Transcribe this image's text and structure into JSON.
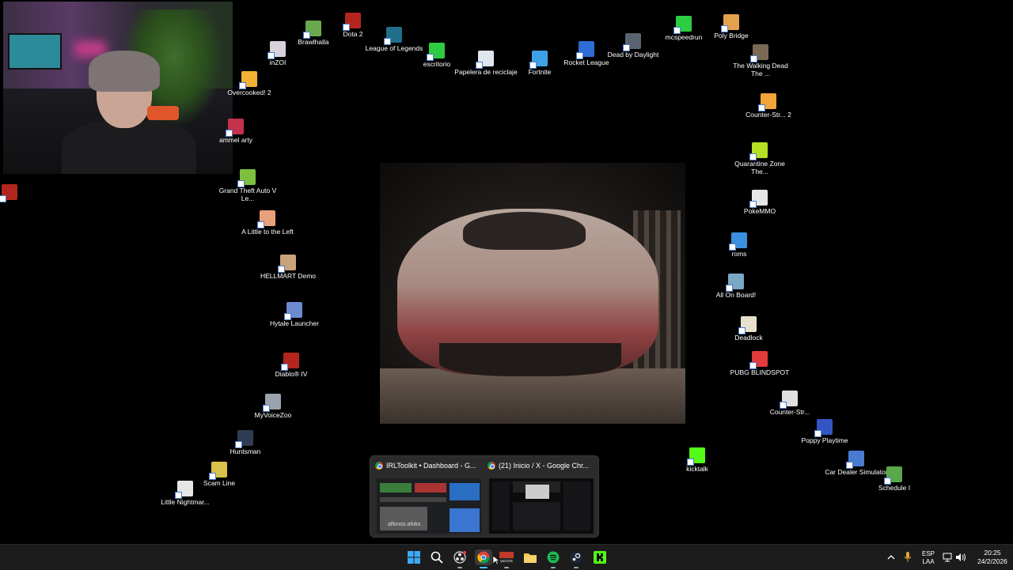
{
  "desktop_icons": [
    {
      "label": "Brawlhalla",
      "icon": "brawlhalla-icon",
      "color": "#6aa84f"
    },
    {
      "label": "Dota 2",
      "icon": "dota2-icon",
      "color": "#b3261e"
    },
    {
      "label": "League of Legends",
      "icon": "league-of-legends-icon",
      "color": "#1f6f8b"
    },
    {
      "label": "escritorio",
      "icon": "tree-icon",
      "color": "#2ecc40"
    },
    {
      "label": "Papelera de reciclaje",
      "icon": "recycle-bin-icon",
      "color": "#dfe6ee"
    },
    {
      "label": "Fortnite",
      "icon": "fortnite-icon",
      "color": "#3ea0e6"
    },
    {
      "label": "Rocket League",
      "icon": "rocket-league-icon",
      "color": "#2d6dd4"
    },
    {
      "label": "Dead by Daylight",
      "icon": "dead-by-daylight-icon",
      "color": "#5a6470"
    },
    {
      "label": "mcspeedrun",
      "icon": "tree-icon",
      "color": "#2ecc40"
    },
    {
      "label": "Poly Bridge",
      "icon": "poly-bridge-icon",
      "color": "#e3a14b"
    },
    {
      "label": "inZOI",
      "icon": "inzoi-icon",
      "color": "#d7d2db"
    },
    {
      "label": "Overcooked! 2",
      "icon": "overcooked-icon",
      "color": "#f2b134"
    },
    {
      "label": "ammel arty",
      "icon": "game-icon",
      "color": "#c4314b"
    },
    {
      "label": "Grand Theft Auto V Le...",
      "icon": "gta-v-icon",
      "color": "#7fbf3f"
    },
    {
      "label": "A Little to the Left",
      "icon": "a-little-to-the-left-icon",
      "color": "#e8a07a"
    },
    {
      "label": "HELLMART Demo",
      "icon": "hellmart-icon",
      "color": "#c9a37a"
    },
    {
      "label": "Hytale Launcher",
      "icon": "hytale-icon",
      "color": "#6c8ad0"
    },
    {
      "label": "Diablo® IV",
      "icon": "diablo-icon",
      "color": "#b3261e"
    },
    {
      "label": "MyVoiceZoo",
      "icon": "myvoicezoo-icon",
      "color": "#9aa3ad"
    },
    {
      "label": "Huntsman",
      "icon": "huntsman-icon",
      "color": "#2f3b52"
    },
    {
      "label": "Scam Line",
      "icon": "scam-line-icon",
      "color": "#d9c24a"
    },
    {
      "label": "Little Nightmar...",
      "icon": "little-nightmares-icon",
      "color": "#e6e6e6"
    },
    {
      "label": "The Walking Dead The ...",
      "icon": "walking-dead-icon",
      "color": "#7a6a55"
    },
    {
      "label": "Counter-Str... 2",
      "icon": "counter-strike-icon",
      "color": "#f2a33a"
    },
    {
      "label": "Quarantine Zone The...",
      "icon": "quarantine-zone-icon",
      "color": "#b6e022"
    },
    {
      "label": "PokeMMO",
      "icon": "pokemmo-icon",
      "color": "#e6e6e6"
    },
    {
      "label": "roms",
      "icon": "internet-explorer-icon",
      "color": "#3a8fe0"
    },
    {
      "label": "All On Board!",
      "icon": "all-on-board-icon",
      "color": "#7aa8c4"
    },
    {
      "label": "Deadlock",
      "icon": "deadlock-icon",
      "color": "#e8e0cc"
    },
    {
      "label": "PUBG BLINDSPOT",
      "icon": "pubg-icon",
      "color": "#e23b3b"
    },
    {
      "label": "Counter-Str...",
      "icon": "counter-strike-icon",
      "color": "#e0e0e0"
    },
    {
      "label": "Poppy Playtime",
      "icon": "poppy-playtime-icon",
      "color": "#3355c4"
    },
    {
      "label": "Car Dealer Simulator",
      "icon": "car-dealer-icon",
      "color": "#4a7bd0"
    },
    {
      "label": "Schedule I",
      "icon": "schedule-i-icon",
      "color": "#5aa84a"
    },
    {
      "label": "kicktalk",
      "icon": "kick-icon",
      "color": "#53fc18"
    },
    {
      "label": "",
      "icon": "small-app-icon",
      "color": "#b3261e"
    }
  ],
  "thumbnails": [
    {
      "title": "IRLToolkit • Dashboard - G...",
      "overlay": "alfonso.afoks"
    },
    {
      "title": "(21) Inicio / X - Google Chr..."
    }
  ],
  "taskbar": {
    "apps": [
      "windows-start-icon",
      "search-icon",
      "obs-icon",
      "chrome-icon",
      "store-icon",
      "file-explorer-icon",
      "spotify-icon",
      "steam-icon",
      "kick-icon"
    ],
    "store_badge": "WISTER",
    "lang_1": "ESP",
    "lang_2": "LAA",
    "time": "20:25",
    "date": "24/2/2026"
  }
}
